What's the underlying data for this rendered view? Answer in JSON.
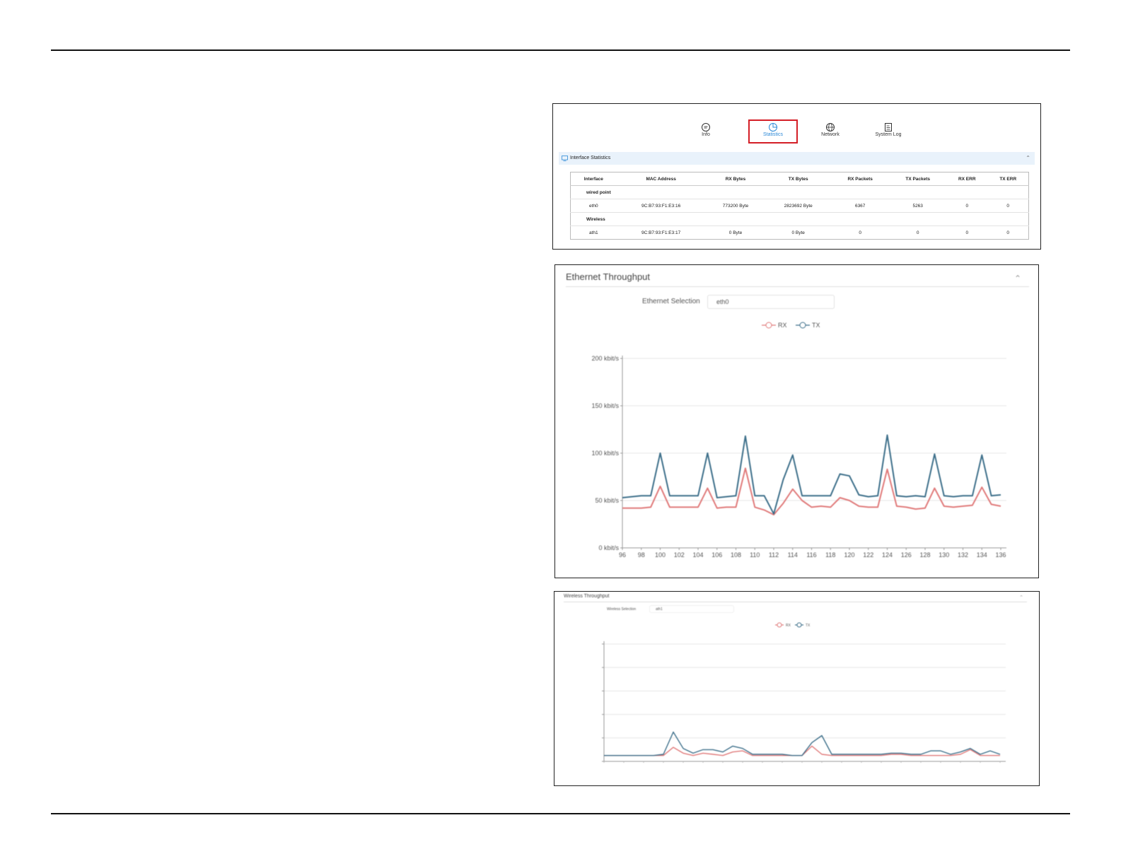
{
  "nav": {
    "items": [
      {
        "label": "Info",
        "icon": "chat-icon"
      },
      {
        "label": "Statistics",
        "icon": "pie-chart-icon"
      },
      {
        "label": "Network",
        "icon": "globe-icon"
      },
      {
        "label": "System Log",
        "icon": "document-icon"
      }
    ],
    "active": "Statistics"
  },
  "interface_stats": {
    "title": "Interface Statistics",
    "columns": [
      "Interface",
      "MAC Address",
      "RX Bytes",
      "TX Bytes",
      "RX Packets",
      "TX Packets",
      "RX ERR",
      "TX ERR"
    ],
    "groups": [
      {
        "name": "wired point",
        "rows": [
          [
            "eth0",
            "9C:B7:93:F1:E3:16",
            "773200 Byte",
            "2823692 Byte",
            "6367",
            "5263",
            "0",
            "0"
          ]
        ]
      },
      {
        "name": "Wireless",
        "rows": [
          [
            "ath1",
            "9C:B7:93:F1:E3:17",
            "0 Byte",
            "0 Byte",
            "0",
            "0",
            "0",
            "0"
          ]
        ]
      }
    ]
  },
  "ethernet": {
    "title": "Ethernet Throughput",
    "selection_label": "Ethernet Selection",
    "selection_value": "eth0",
    "accent_rx": "#e07a7a",
    "accent_tx": "#3d6f8a"
  },
  "wireless": {
    "title": "Wireless Throughput",
    "selection_label": "Wireless Selection",
    "selection_value": "ath1"
  },
  "chart_data": [
    {
      "type": "line",
      "title": "Ethernet Throughput",
      "legend": [
        "RX",
        "TX"
      ],
      "legend_position": "top-center",
      "grid": true,
      "x": [
        96,
        97,
        98,
        99,
        100,
        101,
        102,
        103,
        104,
        105,
        106,
        107,
        108,
        109,
        110,
        111,
        112,
        113,
        114,
        115,
        116,
        117,
        118,
        119,
        120,
        121,
        122,
        123,
        124,
        125,
        126,
        127,
        128,
        129,
        130,
        131,
        132,
        133,
        134,
        135,
        136
      ],
      "xticks": [
        "96",
        "98",
        "100",
        "102",
        "104",
        "106",
        "108",
        "110",
        "112",
        "114",
        "116",
        "118",
        "120",
        "122",
        "124",
        "126",
        "128",
        "130",
        "132",
        "134",
        "136"
      ],
      "yticks": [
        "0 kbit/s",
        "50 kbit/s",
        "100 kbit/s",
        "150 kbit/s",
        "200 kbit/s"
      ],
      "ylim": [
        0,
        200
      ],
      "series": [
        {
          "name": "RX",
          "color": "#e07a7a",
          "values": [
            42,
            42,
            42,
            43,
            65,
            43,
            43,
            43,
            43,
            63,
            42,
            43,
            43,
            84,
            43,
            40,
            35,
            47,
            62,
            50,
            43,
            44,
            43,
            53,
            50,
            44,
            43,
            43,
            83,
            44,
            43,
            41,
            42,
            63,
            44,
            43,
            44,
            45,
            64,
            46,
            44
          ]
        },
        {
          "name": "TX",
          "color": "#3d6f8a",
          "values": [
            53,
            54,
            55,
            55,
            100,
            55,
            55,
            55,
            55,
            100,
            53,
            54,
            55,
            118,
            55,
            55,
            36,
            72,
            98,
            55,
            55,
            55,
            55,
            78,
            76,
            56,
            54,
            55,
            119,
            55,
            54,
            55,
            54,
            99,
            55,
            54,
            55,
            55,
            98,
            55,
            56
          ]
        }
      ]
    },
    {
      "type": "line",
      "title": "Wireless Throughput",
      "legend": [
        "RX",
        "TX"
      ],
      "legend_position": "top-center",
      "grid": true,
      "ylim": [
        0,
        100
      ],
      "series": [
        {
          "name": "RX",
          "color": "#e07a7a",
          "values": [
            5,
            5,
            5,
            5,
            5,
            5,
            5,
            12,
            7,
            5,
            7,
            6,
            5,
            8,
            9,
            5,
            5,
            5,
            5,
            5,
            5,
            13,
            6,
            5,
            5,
            5,
            5,
            5,
            5,
            6,
            6,
            5,
            5,
            5,
            5,
            5,
            6,
            10,
            5,
            5,
            5
          ]
        },
        {
          "name": "TX",
          "color": "#3d6f8a",
          "values": [
            5,
            5,
            5,
            5,
            5,
            5,
            6,
            25,
            11,
            7,
            10,
            10,
            8,
            13,
            11,
            6,
            6,
            6,
            6,
            5,
            5,
            16,
            22,
            6,
            6,
            6,
            6,
            6,
            6,
            7,
            7,
            6,
            6,
            9,
            9,
            6,
            8,
            11,
            6,
            9,
            6
          ]
        }
      ]
    }
  ]
}
